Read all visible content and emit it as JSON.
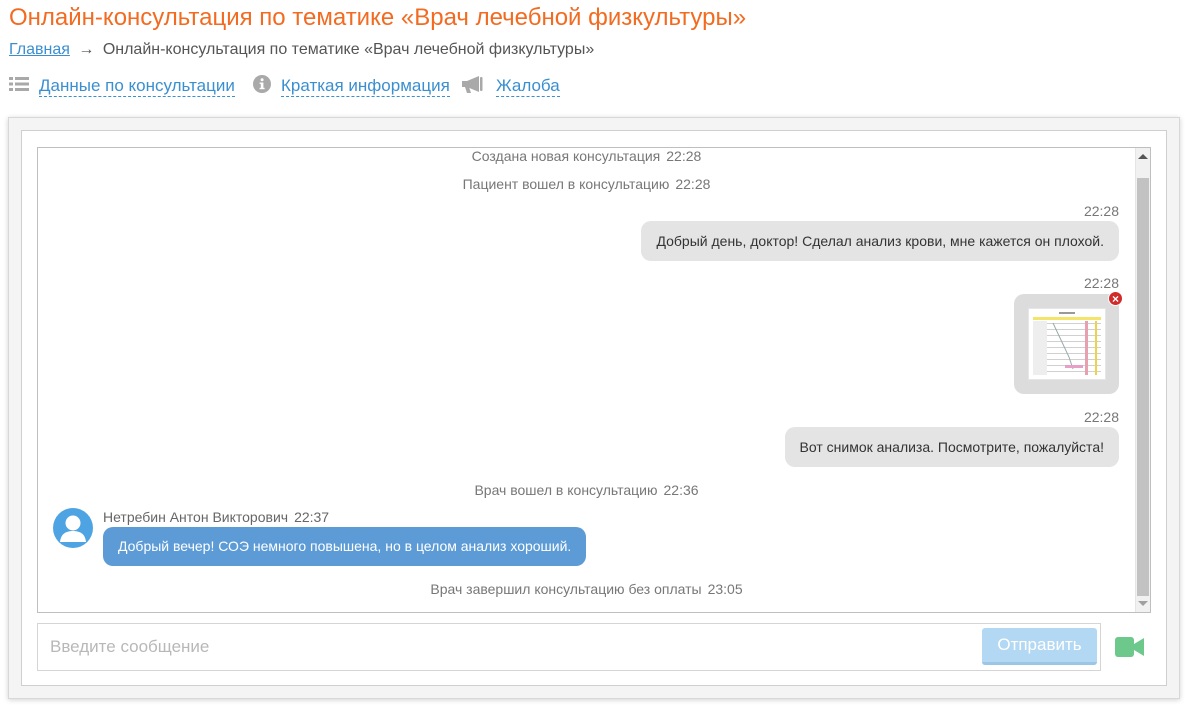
{
  "page": {
    "title": "Онлайн-консультация по тематике «Врач лечебной физкультуры»"
  },
  "breadcrumb": {
    "home": "Главная",
    "arrow": "→",
    "current": "Онлайн-консультация по тематике «Врач лечебной физкультуры»"
  },
  "actions": [
    {
      "label": "Данные по консультации",
      "icon": "list-icon"
    },
    {
      "label": "Краткая информация",
      "icon": "info-icon"
    },
    {
      "label": "Жалоба",
      "icon": "megaphone-icon"
    }
  ],
  "chat": {
    "events": [
      {
        "text": "Создана новая консультация",
        "time": "22:28"
      },
      {
        "text": "Пациент вошел в консультацию",
        "time": "22:28"
      },
      {
        "text": "Врач вошел в консультацию",
        "time": "22:36"
      },
      {
        "text": "Врач завершил консультацию без оплаты",
        "time": "23:05"
      }
    ],
    "patient_messages": [
      {
        "time": "22:28",
        "text": "Добрый день, доктор! Сделал анализ крови, мне кажется он плохой."
      },
      {
        "time": "22:28",
        "attachment": "image-thumbnail"
      },
      {
        "time": "22:28",
        "text": "Вот снимок анализа. Посмотрите, пожалуйста!"
      }
    ],
    "doctor_message": {
      "name": "Нетребин Антон Викторович",
      "time": "22:37",
      "text": "Добрый вечер! СОЭ немного повышена, но в целом анализ хороший."
    }
  },
  "composer": {
    "placeholder": "Введите сообщение",
    "send_label": "Отправить",
    "video_icon": "video-camera-icon"
  },
  "colors": {
    "title": "#f26b21",
    "link": "#3a8fd0",
    "doctor_bubble": "#5c9bd5",
    "patient_bubble": "#e4e4e4",
    "send_button": "#b3d8f3",
    "video_icon": "#6cc98b"
  }
}
